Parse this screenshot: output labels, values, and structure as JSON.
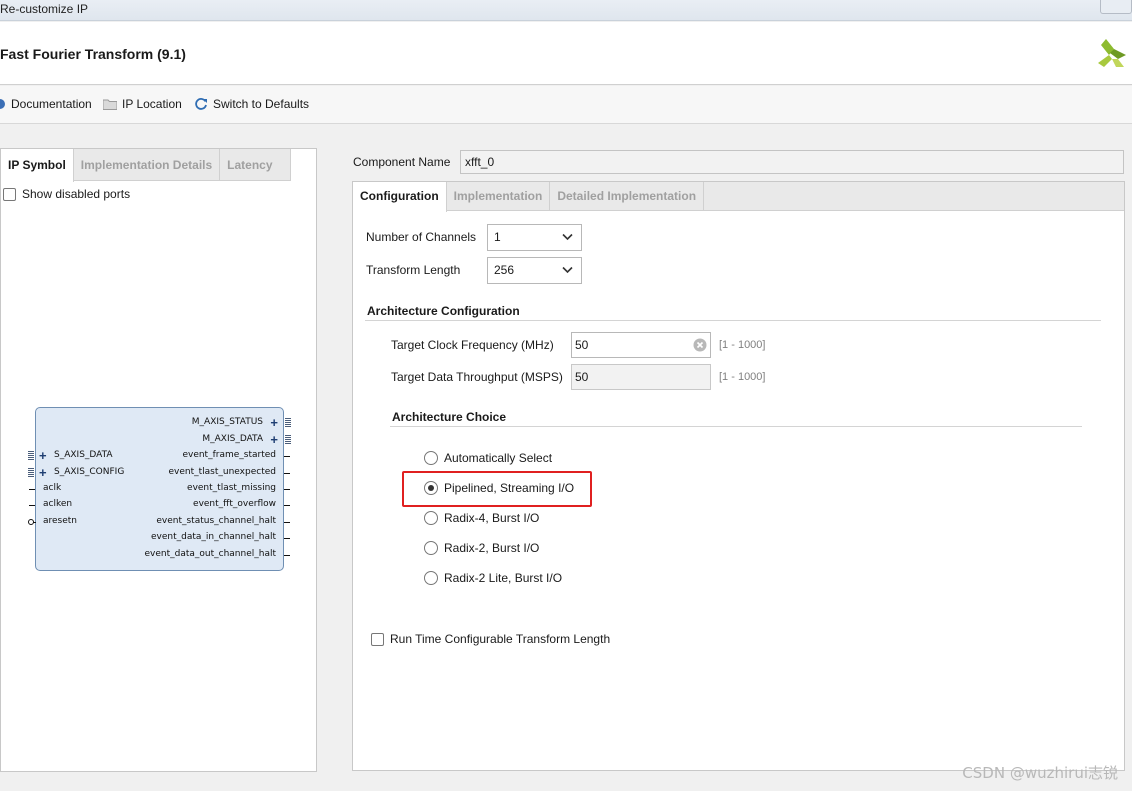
{
  "window": {
    "title": "Re-customize IP"
  },
  "header": {
    "title": "Fast Fourier Transform (9.1)",
    "logo_icon": "xilinx-logo"
  },
  "toolbar": {
    "documentation": "Documentation",
    "ip_location": "IP Location",
    "switch_defaults": "Switch to Defaults"
  },
  "left": {
    "tabs": [
      "IP Symbol",
      "Implementation Details",
      "Latency"
    ],
    "show_disabled_ports": "Show disabled ports",
    "symbol": {
      "right_ports": [
        "M_AXIS_STATUS",
        "M_AXIS_DATA",
        "event_frame_started",
        "event_tlast_unexpected",
        "event_tlast_missing",
        "event_fft_overflow",
        "event_status_channel_halt",
        "event_data_in_channel_halt",
        "event_data_out_channel_halt"
      ],
      "left_ports": [
        "S_AXIS_DATA",
        "S_AXIS_CONFIG",
        "aclk",
        "aclken",
        "aresetn"
      ]
    }
  },
  "component": {
    "label": "Component Name",
    "value": "xfft_0"
  },
  "right": {
    "tabs": [
      "Configuration",
      "Implementation",
      "Detailed Implementation"
    ],
    "num_channels": {
      "label": "Number of Channels",
      "value": "1"
    },
    "transform_length": {
      "label": "Transform Length",
      "value": "256"
    },
    "arch_config": {
      "title": "Architecture Configuration",
      "clock": {
        "label": "Target Clock Frequency (MHz)",
        "value": "50",
        "range": "[1 - 1000]"
      },
      "throughput": {
        "label": "Target Data Throughput (MSPS)",
        "value": "50",
        "range": "[1 - 1000]"
      }
    },
    "arch_choice": {
      "title": "Architecture Choice",
      "options": [
        "Automatically Select",
        "Pipelined, Streaming I/O",
        "Radix-4, Burst I/O",
        "Radix-2, Burst I/O",
        "Radix-2 Lite, Burst I/O"
      ],
      "selected": "Pipelined, Streaming I/O"
    },
    "runtime_length": "Run Time Configurable Transform Length"
  },
  "watermark": "CSDN @wuzhirui志锐",
  "colors": {
    "highlight": "#e02020",
    "block_fill": "#dfe9f5",
    "block_border": "#6f8fb3"
  }
}
